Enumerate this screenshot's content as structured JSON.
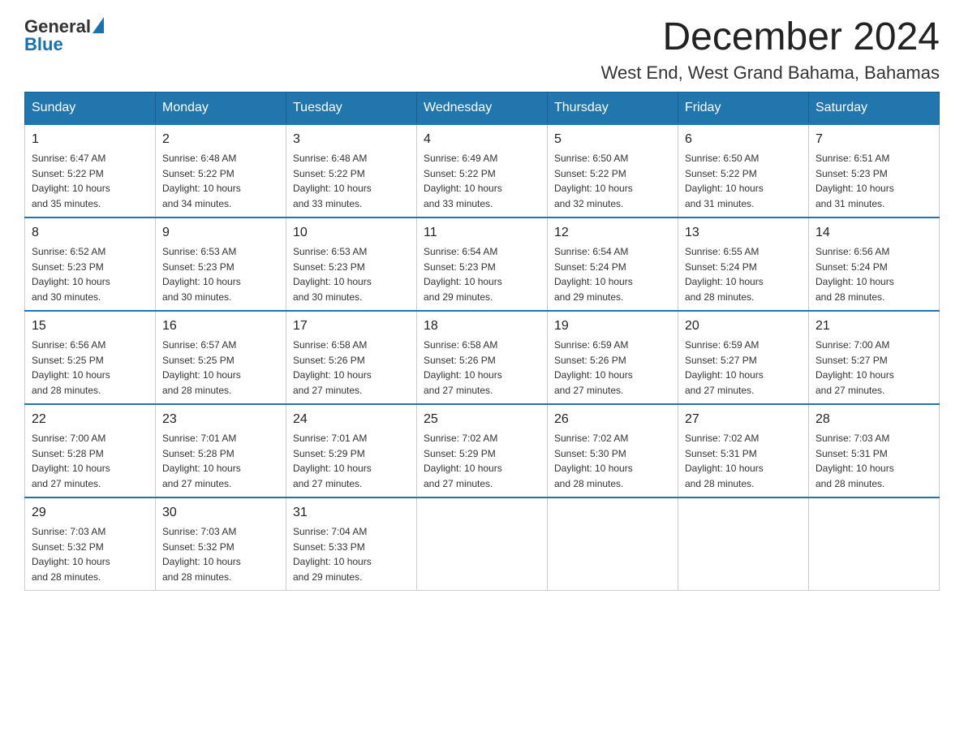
{
  "header": {
    "logo": {
      "general": "General",
      "blue": "Blue",
      "aria": "GeneralBlue logo"
    },
    "title": "December 2024",
    "subtitle": "West End, West Grand Bahama, Bahamas"
  },
  "calendar": {
    "days_of_week": [
      "Sunday",
      "Monday",
      "Tuesday",
      "Wednesday",
      "Thursday",
      "Friday",
      "Saturday"
    ],
    "weeks": [
      [
        {
          "day": "1",
          "sunrise": "6:47 AM",
          "sunset": "5:22 PM",
          "daylight": "10 hours and 35 minutes."
        },
        {
          "day": "2",
          "sunrise": "6:48 AM",
          "sunset": "5:22 PM",
          "daylight": "10 hours and 34 minutes."
        },
        {
          "day": "3",
          "sunrise": "6:48 AM",
          "sunset": "5:22 PM",
          "daylight": "10 hours and 33 minutes."
        },
        {
          "day": "4",
          "sunrise": "6:49 AM",
          "sunset": "5:22 PM",
          "daylight": "10 hours and 33 minutes."
        },
        {
          "day": "5",
          "sunrise": "6:50 AM",
          "sunset": "5:22 PM",
          "daylight": "10 hours and 32 minutes."
        },
        {
          "day": "6",
          "sunrise": "6:50 AM",
          "sunset": "5:22 PM",
          "daylight": "10 hours and 31 minutes."
        },
        {
          "day": "7",
          "sunrise": "6:51 AM",
          "sunset": "5:23 PM",
          "daylight": "10 hours and 31 minutes."
        }
      ],
      [
        {
          "day": "8",
          "sunrise": "6:52 AM",
          "sunset": "5:23 PM",
          "daylight": "10 hours and 30 minutes."
        },
        {
          "day": "9",
          "sunrise": "6:53 AM",
          "sunset": "5:23 PM",
          "daylight": "10 hours and 30 minutes."
        },
        {
          "day": "10",
          "sunrise": "6:53 AM",
          "sunset": "5:23 PM",
          "daylight": "10 hours and 30 minutes."
        },
        {
          "day": "11",
          "sunrise": "6:54 AM",
          "sunset": "5:23 PM",
          "daylight": "10 hours and 29 minutes."
        },
        {
          "day": "12",
          "sunrise": "6:54 AM",
          "sunset": "5:24 PM",
          "daylight": "10 hours and 29 minutes."
        },
        {
          "day": "13",
          "sunrise": "6:55 AM",
          "sunset": "5:24 PM",
          "daylight": "10 hours and 28 minutes."
        },
        {
          "day": "14",
          "sunrise": "6:56 AM",
          "sunset": "5:24 PM",
          "daylight": "10 hours and 28 minutes."
        }
      ],
      [
        {
          "day": "15",
          "sunrise": "6:56 AM",
          "sunset": "5:25 PM",
          "daylight": "10 hours and 28 minutes."
        },
        {
          "day": "16",
          "sunrise": "6:57 AM",
          "sunset": "5:25 PM",
          "daylight": "10 hours and 28 minutes."
        },
        {
          "day": "17",
          "sunrise": "6:58 AM",
          "sunset": "5:26 PM",
          "daylight": "10 hours and 27 minutes."
        },
        {
          "day": "18",
          "sunrise": "6:58 AM",
          "sunset": "5:26 PM",
          "daylight": "10 hours and 27 minutes."
        },
        {
          "day": "19",
          "sunrise": "6:59 AM",
          "sunset": "5:26 PM",
          "daylight": "10 hours and 27 minutes."
        },
        {
          "day": "20",
          "sunrise": "6:59 AM",
          "sunset": "5:27 PM",
          "daylight": "10 hours and 27 minutes."
        },
        {
          "day": "21",
          "sunrise": "7:00 AM",
          "sunset": "5:27 PM",
          "daylight": "10 hours and 27 minutes."
        }
      ],
      [
        {
          "day": "22",
          "sunrise": "7:00 AM",
          "sunset": "5:28 PM",
          "daylight": "10 hours and 27 minutes."
        },
        {
          "day": "23",
          "sunrise": "7:01 AM",
          "sunset": "5:28 PM",
          "daylight": "10 hours and 27 minutes."
        },
        {
          "day": "24",
          "sunrise": "7:01 AM",
          "sunset": "5:29 PM",
          "daylight": "10 hours and 27 minutes."
        },
        {
          "day": "25",
          "sunrise": "7:02 AM",
          "sunset": "5:29 PM",
          "daylight": "10 hours and 27 minutes."
        },
        {
          "day": "26",
          "sunrise": "7:02 AM",
          "sunset": "5:30 PM",
          "daylight": "10 hours and 28 minutes."
        },
        {
          "day": "27",
          "sunrise": "7:02 AM",
          "sunset": "5:31 PM",
          "daylight": "10 hours and 28 minutes."
        },
        {
          "day": "28",
          "sunrise": "7:03 AM",
          "sunset": "5:31 PM",
          "daylight": "10 hours and 28 minutes."
        }
      ],
      [
        {
          "day": "29",
          "sunrise": "7:03 AM",
          "sunset": "5:32 PM",
          "daylight": "10 hours and 28 minutes."
        },
        {
          "day": "30",
          "sunrise": "7:03 AM",
          "sunset": "5:32 PM",
          "daylight": "10 hours and 28 minutes."
        },
        {
          "day": "31",
          "sunrise": "7:04 AM",
          "sunset": "5:33 PM",
          "daylight": "10 hours and 29 minutes."
        },
        null,
        null,
        null,
        null
      ]
    ],
    "labels": {
      "sunrise": "Sunrise:",
      "sunset": "Sunset:",
      "daylight": "Daylight:"
    }
  }
}
